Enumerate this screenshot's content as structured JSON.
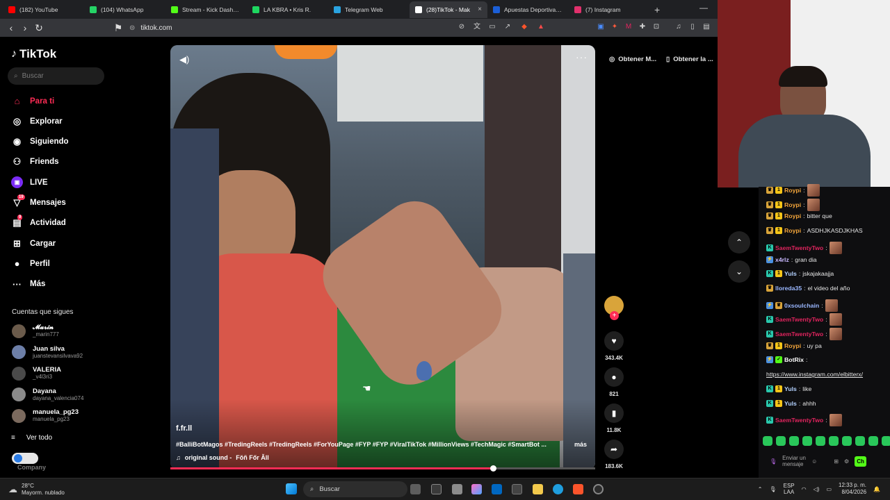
{
  "browser": {
    "tabs": [
      {
        "label": "(182) YouTube",
        "color": "#ff0000"
      },
      {
        "label": "(104) WhatsApp",
        "color": "#25d366"
      },
      {
        "label": "Stream - Kick Dashboard",
        "color": "#53fc18"
      },
      {
        "label": "LA KBRA • Kris R.",
        "color": "#1ed760"
      },
      {
        "label": "Telegram Web",
        "color": "#2aa3e0"
      },
      {
        "label": "(28)TikTok - Mak",
        "color": "#ffffff",
        "active": true
      },
      {
        "label": "Apuestas Deportivas Online",
        "color": "#1b5fd8"
      },
      {
        "label": "(7) Instagram",
        "color": "#e1306c"
      }
    ],
    "new_tab": "+",
    "minimize": "—",
    "url": "tiktok.com"
  },
  "tiktok": {
    "logo": "TikTok",
    "search_placeholder": "Buscar",
    "nav": [
      {
        "label": "Para ti",
        "icon": "home-icon",
        "active": true
      },
      {
        "label": "Explorar",
        "icon": "compass-icon"
      },
      {
        "label": "Siguiendo",
        "icon": "following-icon"
      },
      {
        "label": "Friends",
        "icon": "friends-icon"
      },
      {
        "label": "LIVE",
        "icon": "live-icon"
      },
      {
        "label": "Mensajes",
        "icon": "messages-icon",
        "badge": "19"
      },
      {
        "label": "Actividad",
        "icon": "activity-icon",
        "badge": "9"
      },
      {
        "label": "Cargar",
        "icon": "upload-icon"
      },
      {
        "label": "Perfil",
        "icon": "profile-icon"
      },
      {
        "label": "Más",
        "icon": "more-icon"
      }
    ],
    "following_title": "Cuentas que sigues",
    "following": [
      {
        "name": "𝓜𝓪𝓻𝓲𝓷",
        "user": "_marin777"
      },
      {
        "name": "Juan silva",
        "user": "juanstevansilvava92"
      },
      {
        "name": "VALERIA",
        "user": "_v4l3ri3"
      },
      {
        "name": "Dayana",
        "user": "dayana_valencia074"
      },
      {
        "name": "manuela_pg23",
        "user": "manuela_pg23"
      }
    ],
    "see_all": "Ver todo",
    "company": "Company",
    "video": {
      "author": "f.fr.ll",
      "description": "#BalliBotMagos #TredingReels #TredingReels #ForYouPage #FYP #FYP #ViralTikTok #MillionViews #TechMagic #SmartBot ...",
      "more": "más",
      "sound": "original sound - ",
      "sound_author": "Fŏñ Főr Ăll",
      "progress": 0.76
    },
    "actions": {
      "likes": "343.4K",
      "comments": "821",
      "saves": "11.8K",
      "shares": "183.6K"
    },
    "top_pills": [
      "Obtener M...",
      "Obtener la ..."
    ]
  },
  "chat": {
    "messages": [
      {
        "user": "Roypi",
        "text": "",
        "emote": true,
        "color": "#f4a63b",
        "badges": [
          "crown",
          "coin"
        ]
      },
      {
        "user": "Roypi",
        "text": "",
        "emote": true,
        "color": "#f4a63b",
        "badges": [
          "crown",
          "coin"
        ]
      },
      {
        "user": "Roypi",
        "text": "bitter que",
        "emote": false,
        "color": "#f4a63b",
        "badges": [
          "crown",
          "coin"
        ]
      },
      {
        "user": "Roypi",
        "text": "ASDHJKASDJKHAS",
        "emote": false,
        "color": "#f4a63b",
        "badges": [
          "crown",
          "coin"
        ]
      },
      {
        "user": "SaemTwentyTwo",
        "text": "",
        "emote": true,
        "color": "#e0245e",
        "badges": [
          "kick"
        ]
      },
      {
        "user": "x4rlz",
        "text": "gran dia",
        "emote": false,
        "color": "#c9b8ff",
        "badges": [
          "bolt"
        ]
      },
      {
        "user": "Yuls",
        "text": "jskajakaajja",
        "emote": false,
        "color": "#b3d1ff",
        "badges": [
          "kick",
          "coin"
        ]
      },
      {
        "user": "lloreda35",
        "text": "el video del año",
        "emote": false,
        "color": "#9ab7ff",
        "badges": [
          "crown"
        ]
      },
      {
        "user": "0xsoulchain",
        "text": "",
        "emote": true,
        "color": "#9ab7ff",
        "badges": [
          "bolt",
          "crown"
        ]
      },
      {
        "user": "SaemTwentyTwo",
        "text": "",
        "emote": true,
        "color": "#e0245e",
        "badges": [
          "kick"
        ]
      },
      {
        "user": "SaemTwentyTwo",
        "text": "",
        "emote": true,
        "color": "#e0245e",
        "badges": [
          "kick"
        ]
      },
      {
        "user": "Roypi",
        "text": "uy pa",
        "emote": false,
        "color": "#f4a63b",
        "badges": [
          "crown",
          "coin"
        ]
      },
      {
        "user": "BotRix",
        "text": "",
        "emote": false,
        "color": "#ffffff",
        "badges": [
          "bolt",
          "bot"
        ]
      },
      {
        "user": "",
        "text": "https://www.instagram.com/elbitterx/",
        "emote": false,
        "color": "#ffffff",
        "badges": []
      },
      {
        "user": "Yuls",
        "text": "like",
        "emote": false,
        "color": "#b3d1ff",
        "badges": [
          "kick",
          "coin"
        ]
      },
      {
        "user": "Yuls",
        "text": "ahhh",
        "emote": false,
        "color": "#b3d1ff",
        "badges": [
          "kick",
          "coin"
        ]
      },
      {
        "user": "SaemTwentyTwo",
        "text": "",
        "emote": true,
        "color": "#e0245e",
        "badges": [
          "kick"
        ]
      }
    ],
    "input_placeholder": "Enviar un mensaje",
    "send_label": "Ch"
  },
  "taskbar": {
    "temp": "28°C",
    "weather": "Mayorm. nublado",
    "search": "Buscar",
    "lang_top": "ESP",
    "lang_bottom": "LAA",
    "time": "12:33 p. m.",
    "date": "8/04/2026"
  }
}
